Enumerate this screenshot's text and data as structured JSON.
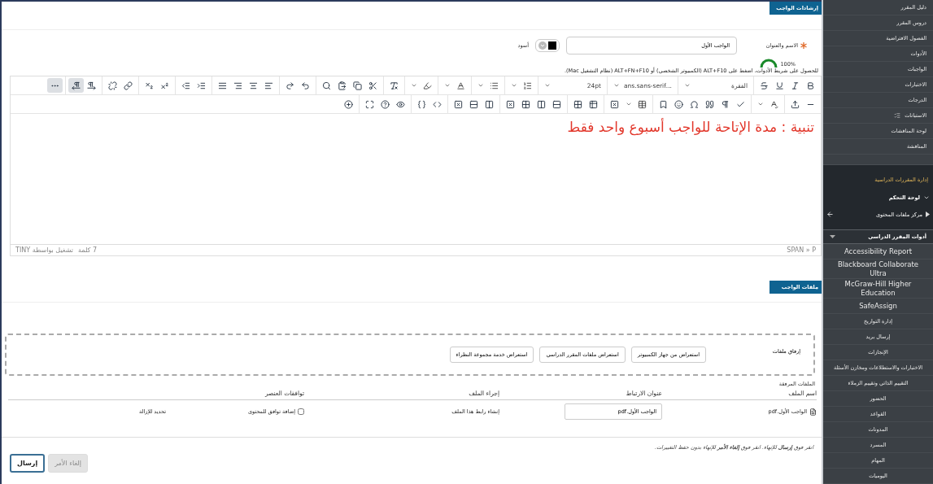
{
  "sidebar": {
    "top_items": [
      {
        "label": "دليل المقرر",
        "kind": "link"
      },
      {
        "label": "دروس المقرر",
        "kind": "link"
      },
      {
        "label": "الفصول الافتراضية",
        "kind": "link"
      },
      {
        "label": "الأدوات",
        "kind": "link"
      },
      {
        "label": "الواجبات",
        "kind": "link"
      },
      {
        "label": "الاختبارات",
        "kind": "link"
      },
      {
        "label": "الدرجات",
        "kind": "link"
      },
      {
        "label": "الاستبانات",
        "kind": "link-with-icon"
      },
      {
        "label": "لوحة المناقشات",
        "kind": "link"
      },
      {
        "label": "المناقشة",
        "kind": "link"
      }
    ],
    "management": {
      "title": "إدارة المقررات الدراسية",
      "items": [
        {
          "label": "لوحة التحكم",
          "kind": "expander",
          "expanded": true
        },
        {
          "label": "مركز ملفات المحتوى",
          "kind": "link"
        }
      ]
    },
    "tools": {
      "title": "أدوات المقرر الدراسي",
      "expanded": true,
      "items": [
        {
          "label": "Accessibility Report",
          "kind": "latin"
        },
        {
          "label": "Blackboard Collaborate Ultra",
          "kind": "latin"
        },
        {
          "label": "McGraw-Hill Higher Education",
          "kind": "latin"
        },
        {
          "label": "SafeAssign",
          "kind": "latin"
        },
        {
          "label": "إدارة التواريخ",
          "kind": "arabic"
        },
        {
          "label": "إرسال بريد",
          "kind": "arabic"
        },
        {
          "label": "الإنجازات",
          "kind": "arabic"
        },
        {
          "label": "الاختبارات والاستطلاعات ومخازن الأسئلة",
          "kind": "arabic"
        },
        {
          "label": "التقييم الذاتي وتقييم الزملاء",
          "kind": "arabic"
        },
        {
          "label": "الحضور",
          "kind": "arabic"
        },
        {
          "label": "القواعد",
          "kind": "arabic"
        },
        {
          "label": "المدونات",
          "kind": "arabic"
        },
        {
          "label": "المسرد",
          "kind": "arabic"
        },
        {
          "label": "المهام",
          "kind": "arabic"
        },
        {
          "label": "اليوميات",
          "kind": "arabic"
        }
      ]
    }
  },
  "instructions": {
    "tab": "إرشادات الواجب",
    "required": true,
    "name_label": "الاسم والعنوان",
    "name_value": "الواجب الأول",
    "color_name": "أسود",
    "color": "#000000",
    "zoom": "100%",
    "hint": "للحصول على شريط الأدوات، اضغط على ALT+F10 (الكمبيوتر الشخصي) أو ALT+FN+F10 (نظام التشغيل Mac)."
  },
  "editor": {
    "format": "الفقرة",
    "font": "...ans.sans-serif",
    "size": "24pt",
    "rtl_selected": true,
    "more_expanded": true,
    "content": "تنبية : مدة الإتاحة للواجب أسبوع واحد فقط",
    "word_count": "7 كلمة",
    "powered": "تشغيل بواسطة TINY",
    "path": "SPAN » P"
  },
  "files": {
    "tab": "ملفات الواجب",
    "attach_label": "إرفاق ملفات",
    "browse_buttons": [
      "استعراض من جهاز الكمبيوتر",
      "استعراض ملفات المقرر الدراسي",
      "استعراض خدمة مجموعة النظراء"
    ],
    "attached_label": "الملفات المرفقة",
    "columns": [
      "اسم الملف",
      "عنوان الارتباط",
      "إجراء الملف",
      "توافقات العنصر"
    ],
    "rows": [
      {
        "file": "الواجب الأول.pdf",
        "link_title": "الواجب الأول.pdf",
        "action": "إنشاء رابط هذا الملف",
        "alignment_checked": false,
        "alignment": "إضافة توافق للمحتوى",
        "remove": "تحديد للإزالة"
      }
    ]
  },
  "footer": {
    "instruction": "انقر فوق **إرسال** للإنهاء. انقر فوق **إلغاء الأمر** للإنهاء بدون حفظ التغييرات.",
    "buttons": [
      {
        "label": "إلغاء الأمر",
        "kind": "cancel"
      },
      {
        "label": "إرسال",
        "kind": "submit"
      }
    ]
  }
}
